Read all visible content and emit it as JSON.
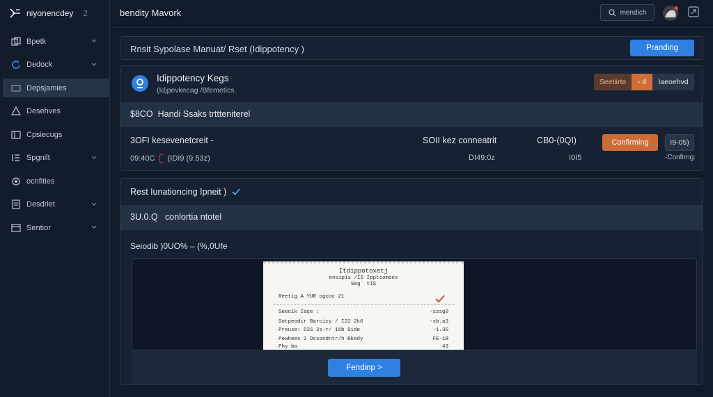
{
  "app": {
    "name": "niyonencdey",
    "badge": "2"
  },
  "header": {
    "title": "bendity Mavork",
    "search_label": "mendich"
  },
  "sidebar": {
    "items": [
      {
        "label": "Bpetk",
        "icon": "layers-icon",
        "chevron": true
      },
      {
        "label": "Dedock",
        "icon": "circle-arrow-icon",
        "chevron": true,
        "icon_color": "#3b8ff0"
      },
      {
        "label": "Depsjamies",
        "icon": "folder-icon",
        "chevron": false,
        "active": true
      },
      {
        "label": "Desehves",
        "icon": "alert-icon",
        "chevron": false
      },
      {
        "label": "Cpsiecugs",
        "icon": "grid-icon",
        "chevron": false
      },
      {
        "label": "Spgnilt",
        "icon": "list-icon",
        "chevron": true
      },
      {
        "label": "ocnfities",
        "icon": "settings-icon",
        "chevron": false
      },
      {
        "label": "Desdriet",
        "icon": "document-icon",
        "chevron": true
      },
      {
        "label": "Sentior",
        "icon": "calendar-icon",
        "chevron": true
      }
    ]
  },
  "breadcrumb": {
    "text": "Rnsit Sypolase Manuat/ Rset (Idippotency )",
    "button": "Pranding"
  },
  "key_panel": {
    "title": "Idippotency Kegs",
    "subtitle": "(Idjpevkecag /Bfemetics.",
    "segments": {
      "a": "Seetiirte",
      "b": "- 4",
      "c": "Iaeoehvd"
    },
    "band": {
      "code": "$8CO",
      "text": "Handi Ssaks trttteniterel"
    },
    "row": {
      "a1": "3OFI kesevenetcreit -",
      "a2": "SOII kez conneatrit",
      "a3": "CB0-(0QI)",
      "b1_pre": "09:40C",
      "b1_post": "(IDI9 (9.53z)",
      "b2": "DI49:0z",
      "b3": "I0I5",
      "b4": "-Confirng:",
      "confirm_button": "Confirming",
      "ghost_button": "I9-05)"
    }
  },
  "result_panel": {
    "title": "Rest Iunationcing Ipneit )",
    "band": {
      "code": "3U.0.Q",
      "text": "conlortia ntotel"
    },
    "line": "Seiodib )0UO% – (%,0Ufe",
    "receipt": {
      "title1": "Itdippotoxetj",
      "title2": "ensipis /IS Ipptiomoes",
      "title3": "S0g´ tIS",
      "header_left": "Reetig A YUR ogcoc 21",
      "rows": [
        {
          "l": "Seecik Iaçe :",
          "r": "-szsg0"
        },
        {
          "l": "Sotpeodir  Barcicy / I22 2k6",
          "r": "-sb.a3"
        },
        {
          "l": "Preuse:  D2S 2s-r/ 15b 9ide",
          "r": "-1.3S"
        },
        {
          "l": "Pewhees  2  Dssondntr/h  Bkedy",
          "r": "FE-1B"
        },
        {
          "l": "Phy bo",
          "r": "43"
        }
      ]
    },
    "footer_button": "Fendinp >"
  },
  "colors": {
    "accent": "#2f80e0",
    "warning": "#cd6b36",
    "danger": "#d9433b",
    "success": "#5ab0e6"
  }
}
